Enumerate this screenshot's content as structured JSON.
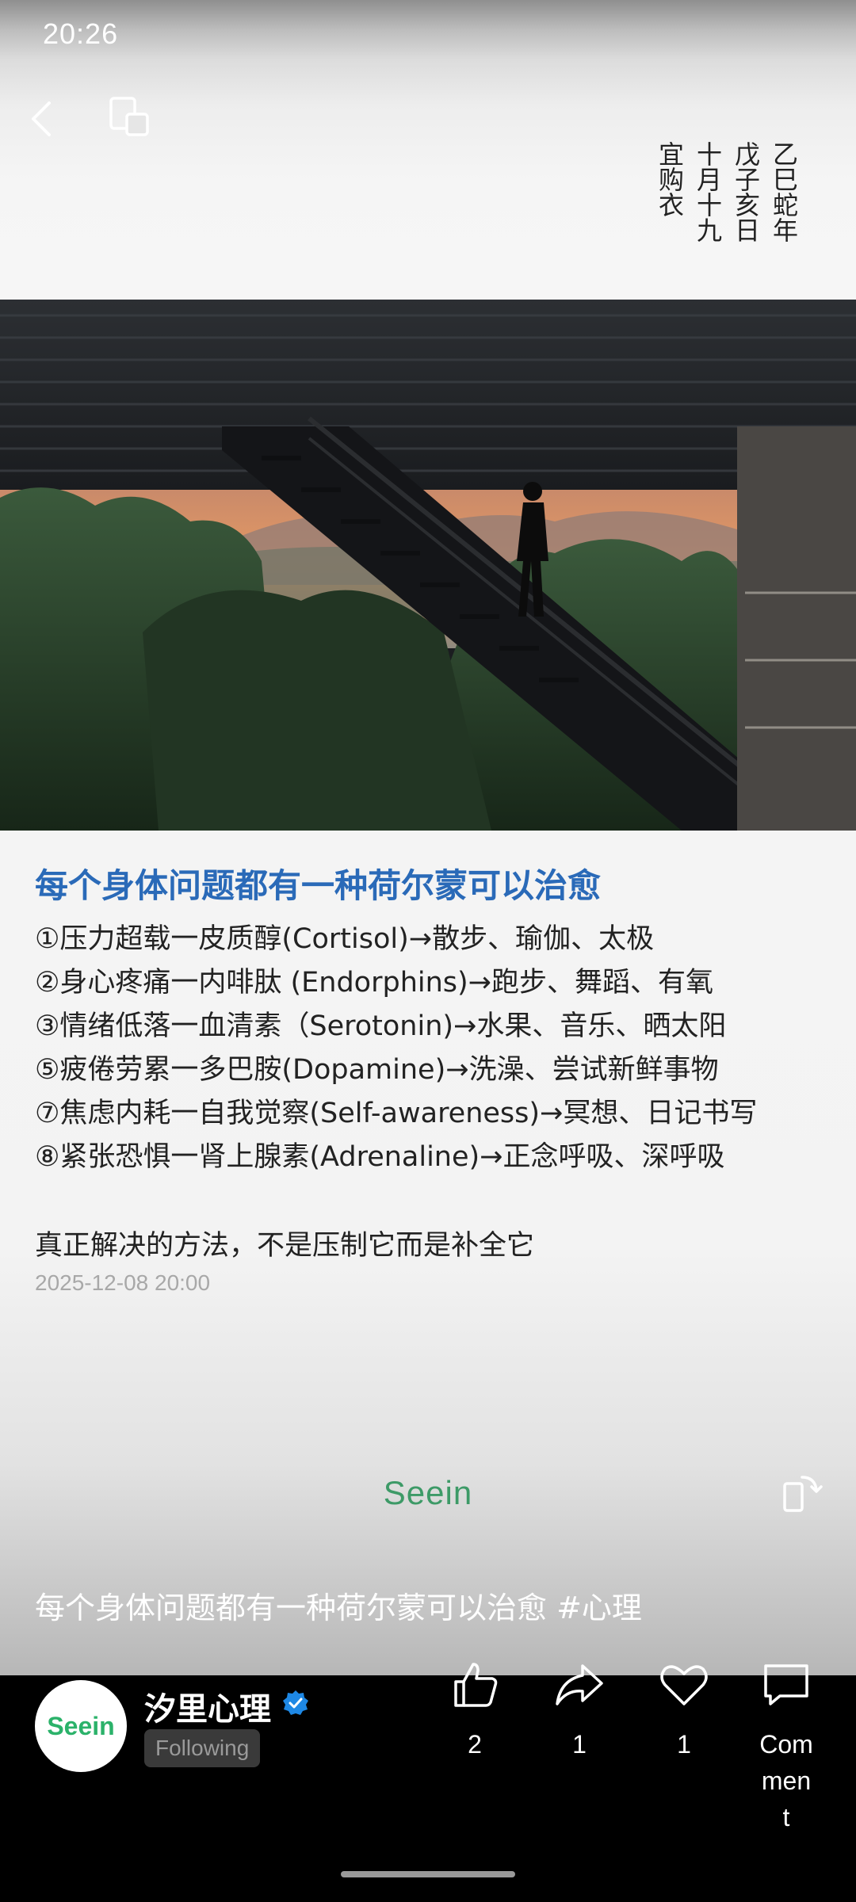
{
  "status_bar": {
    "time": "20:26"
  },
  "almanac": {
    "columns": [
      "乙巳蛇年",
      "戊子亥日",
      "十月十九",
      "宜购衣"
    ]
  },
  "article": {
    "title": "每个身体问题都有一种荷尔蒙可以治愈",
    "items": [
      "①压力超载一皮质醇(Cortisol)→散步、瑜伽、太极",
      "②身心疼痛一内啡肽 (Endorphins)→跑步、舞蹈、有氧",
      "③情绪低落一血清素（Serotonin)→水果、音乐、晒太阳",
      "⑤疲倦劳累一多巴胺(Dopamine)→洗澡、尝试新鲜事物",
      "⑦焦虑内耗一自我觉察(Self-awareness)→冥想、日记书写",
      "⑧紧张恐惧一肾上腺素(Adrenaline)→正念呼吸、深呼吸"
    ],
    "conclusion": "真正解决的方法，不是压制它而是补全它",
    "date": "2025-12-08 20:00",
    "watermark": "Seein"
  },
  "caption": "每个身体问题都有一种荷尔蒙可以治愈 #心理",
  "author": {
    "name": "汐里心理",
    "avatar_text": "Seein",
    "follow_label": "Following"
  },
  "actions": {
    "like_count": "2",
    "share_count": "1",
    "favorite_count": "1",
    "comment_label": "Comment"
  },
  "colors": {
    "title_blue": "#2a6ab8",
    "brand_green": "#3d9a67",
    "verified_blue": "#1e88e5"
  }
}
